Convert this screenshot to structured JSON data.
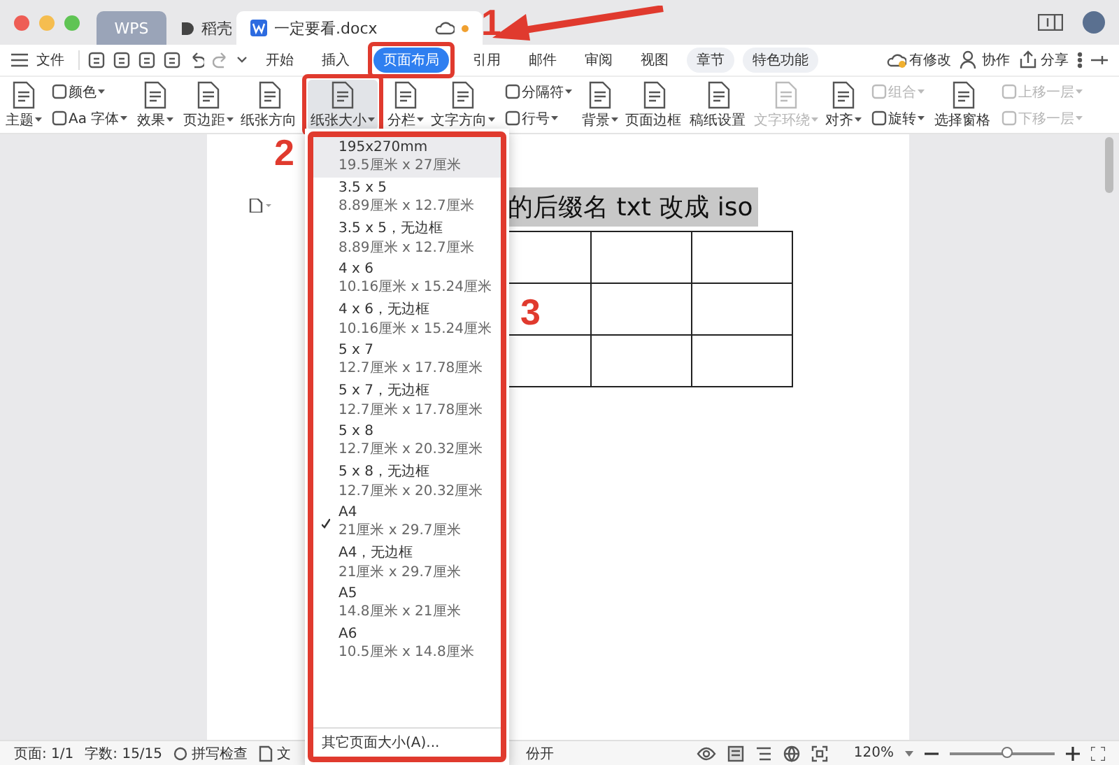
{
  "window": {
    "tabs": [
      {
        "label": "WPS",
        "kind": "app",
        "selected": false
      },
      {
        "label": "稻壳",
        "kind": "store",
        "selected": false
      },
      {
        "label": "一定要看.docx",
        "kind": "doc",
        "selected": true
      }
    ]
  },
  "menu": {
    "file": "文件",
    "tabs": [
      {
        "label": "开始",
        "selected": false,
        "pill": false
      },
      {
        "label": "插入",
        "selected": false,
        "pill": false
      },
      {
        "label": "页面布局",
        "selected": true,
        "pill": false
      },
      {
        "label": "引用",
        "selected": false,
        "pill": false
      },
      {
        "label": "邮件",
        "selected": false,
        "pill": false
      },
      {
        "label": "审阅",
        "selected": false,
        "pill": false
      },
      {
        "label": "视图",
        "selected": false,
        "pill": false
      },
      {
        "label": "章节",
        "selected": false,
        "pill": true
      },
      {
        "label": "特色功能",
        "selected": false,
        "pill": true
      }
    ],
    "actions": [
      {
        "label": "有修改",
        "kind": "cloud"
      },
      {
        "label": "协作",
        "kind": "person"
      },
      {
        "label": "分享",
        "kind": "share"
      }
    ]
  },
  "ribbon": [
    {
      "kind": "big",
      "items": [
        {
          "label": "主题",
          "disabled": false,
          "dropdown": true,
          "pressed": false
        }
      ]
    },
    {
      "kind": "stack",
      "items": [
        {
          "label": "颜色",
          "disabled": false,
          "dropdown": true
        },
        {
          "label": "Aa 字体",
          "disabled": false,
          "dropdown": true
        }
      ]
    },
    {
      "kind": "big",
      "items": [
        {
          "label": "效果",
          "disabled": false,
          "dropdown": true,
          "pressed": false
        }
      ]
    },
    {
      "kind": "big",
      "items": [
        {
          "label": "页边距",
          "disabled": false,
          "dropdown": true,
          "pressed": false
        },
        {
          "label": "纸张方向",
          "disabled": false,
          "dropdown": false,
          "pressed": false
        },
        {
          "label": "纸张大小",
          "disabled": false,
          "dropdown": true,
          "pressed": true
        },
        {
          "label": "分栏",
          "disabled": false,
          "dropdown": true,
          "pressed": false
        },
        {
          "label": "文字方向",
          "disabled": false,
          "dropdown": true,
          "pressed": false
        }
      ]
    },
    {
      "kind": "stack",
      "items": [
        {
          "label": "分隔符",
          "disabled": false,
          "dropdown": true
        },
        {
          "label": "行号",
          "disabled": false,
          "dropdown": true
        }
      ]
    },
    {
      "kind": "big",
      "items": [
        {
          "label": "背景",
          "disabled": false,
          "dropdown": true,
          "pressed": false
        },
        {
          "label": "页面边框",
          "disabled": false,
          "dropdown": false,
          "pressed": false
        },
        {
          "label": "稿纸设置",
          "disabled": false,
          "dropdown": false,
          "pressed": false
        },
        {
          "label": "文字环绕",
          "disabled": true,
          "dropdown": true,
          "pressed": false
        },
        {
          "label": "对齐",
          "disabled": false,
          "dropdown": true,
          "pressed": false
        }
      ]
    },
    {
      "kind": "stack",
      "items": [
        {
          "label": "组合",
          "disabled": true,
          "dropdown": true
        },
        {
          "label": "旋转",
          "disabled": false,
          "dropdown": true
        }
      ]
    },
    {
      "kind": "big",
      "items": [
        {
          "label": "选择窗格",
          "disabled": false,
          "dropdown": false,
          "pressed": false
        }
      ]
    },
    {
      "kind": "stack",
      "items": [
        {
          "label": "上移一层",
          "disabled": true,
          "dropdown": true
        },
        {
          "label": "下移一层",
          "disabled": true,
          "dropdown": true
        }
      ]
    }
  ],
  "document": {
    "heading": "的后缀名 txt 改成 iso"
  },
  "paper_menu": {
    "items": [
      {
        "title": "195x270mm",
        "size": "19.5厘米 x 27厘米",
        "checked": false,
        "highlighted": true
      },
      {
        "title": "3.5 x 5",
        "size": "8.89厘米 x 12.7厘米",
        "checked": false,
        "highlighted": false
      },
      {
        "title": "3.5 x 5，无边框",
        "size": "8.89厘米 x 12.7厘米",
        "checked": false,
        "highlighted": false
      },
      {
        "title": "4 x 6",
        "size": "10.16厘米 x 15.24厘米",
        "checked": false,
        "highlighted": false
      },
      {
        "title": "4 x 6，无边框",
        "size": "10.16厘米 x 15.24厘米",
        "checked": false,
        "highlighted": false
      },
      {
        "title": "5 x 7",
        "size": "12.7厘米 x 17.78厘米",
        "checked": false,
        "highlighted": false
      },
      {
        "title": "5 x 7，无边框",
        "size": "12.7厘米 x 17.78厘米",
        "checked": false,
        "highlighted": false
      },
      {
        "title": "5 x 8",
        "size": "12.7厘米 x 20.32厘米",
        "checked": false,
        "highlighted": false
      },
      {
        "title": "5 x 8，无边框",
        "size": "12.7厘米 x 20.32厘米",
        "checked": false,
        "highlighted": false
      },
      {
        "title": "A4",
        "size": "21厘米 x 29.7厘米",
        "checked": true,
        "highlighted": false
      },
      {
        "title": "A4，无边框",
        "size": "21厘米 x 29.7厘米",
        "checked": false,
        "highlighted": false
      },
      {
        "title": "A5",
        "size": "14.8厘米 x 21厘米",
        "checked": false,
        "highlighted": false
      },
      {
        "title": "A6",
        "size": "10.5厘米 x 14.8厘米",
        "checked": false,
        "highlighted": false
      }
    ],
    "more": "其它页面大小(A)..."
  },
  "status_bar": {
    "page": "页面: 1/1",
    "words": "字数: 15/15",
    "spellcheck": "拼写检查",
    "doc": "文",
    "backup": "份开",
    "zoom": "120%",
    "zoom_slider": {
      "level": 0.55
    }
  },
  "annotations": [
    {
      "number": "1"
    },
    {
      "number": "2"
    },
    {
      "number": "3"
    }
  ]
}
